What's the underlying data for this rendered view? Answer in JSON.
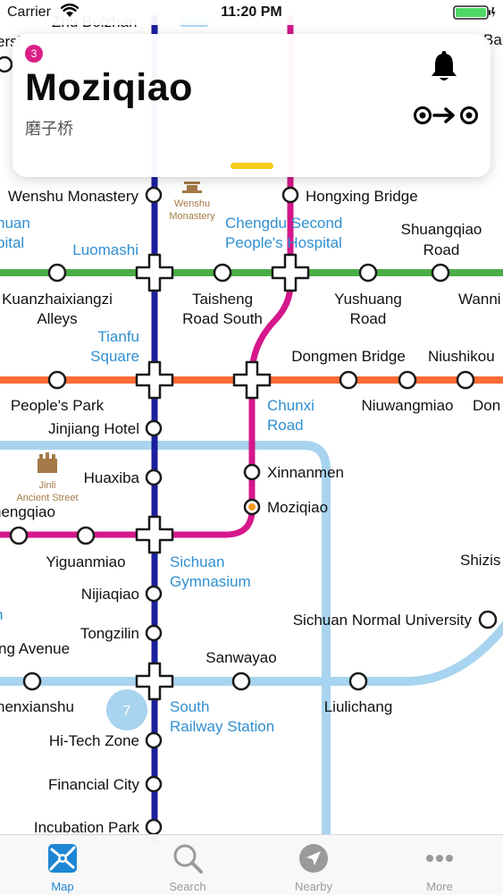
{
  "status_bar": {
    "carrier": "Carrier",
    "time": "11:20 PM"
  },
  "station_card": {
    "badge": "3",
    "title": "Moziqiao",
    "subtitle": "磨子桥",
    "bell_icon": "bell-icon",
    "route_icon": "route-icon"
  },
  "map": {
    "line_colors": {
      "line_1": "#1c1f9e",
      "line_2": "#4aad47",
      "line_3": "#d5178b",
      "line_4": "#ff6a35",
      "line_7": "#a8d4ef"
    },
    "line_badge": "7",
    "edge_labels": [
      "ersi",
      "Zhu Bolzhan",
      "Bal",
      "huan",
      "pital",
      "Wanni",
      "Niushikou",
      "Don",
      "hengqiao",
      "Shizis",
      "n",
      "ng Avenue",
      "henxianshu"
    ],
    "stations": {
      "wenshu_monastery": "Wenshu Monastery",
      "hongxing_bridge": "Hongxing Bridge",
      "chengdu_second_1": "Chengdu Second",
      "chengdu_second_2": "People's Hospital",
      "shuangqiao_1": "Shuangqiao",
      "shuangqiao_2": "Road",
      "luomashi": "Luomashi",
      "kuanzhai_1": "Kuanzhaixiangzi",
      "kuanzhai_2": "Alleys",
      "taisheng_1": "Taisheng",
      "taisheng_2": "Road South",
      "yushuang_1": "Yushuang",
      "yushuang_2": "Road",
      "tianfu_1": "Tianfu",
      "tianfu_2": "Square",
      "dongmen_bridge": "Dongmen Bridge",
      "peoples_park": "People's Park",
      "chunxi_1": "Chunxi",
      "chunxi_2": "Road",
      "niuwangmiao": "Niuwangmiao",
      "jinjiang_hotel": "Jinjiang Hotel",
      "huaxiba": "Huaxiba",
      "xinnanmen": "Xinnanmen",
      "moziqiao": "Moziqiao",
      "yiguanmiao": "Yiguanmiao",
      "sichuan_gym_1": "Sichuan",
      "sichuan_gym_2": "Gymnasium",
      "nijiaqiao": "Nijiaqiao",
      "sichuan_normal": "Sichuan Normal University",
      "tongzilin": "Tongzilin",
      "sanwayao": "Sanwayao",
      "south_rail_1": "South",
      "south_rail_2": "Railway Station",
      "liulichang": "Liulichang",
      "hitech_zone": "Hi-Tech Zone",
      "financial_city": "Financial City",
      "incubation_park": "Incubation Park"
    },
    "landmarks": {
      "wenshu_1": "Wenshu",
      "wenshu_2": "Monastery",
      "jinli_1": "Jinli",
      "jinli_2": "Ancient Street"
    }
  },
  "tab_bar": {
    "active_color": "#1d86d4",
    "tabs": [
      {
        "label": "Map",
        "icon": "map-icon",
        "active": true
      },
      {
        "label": "Search",
        "icon": "search-icon",
        "active": false
      },
      {
        "label": "Nearby",
        "icon": "nearby-icon",
        "active": false
      },
      {
        "label": "More",
        "icon": "more-icon",
        "active": false
      }
    ]
  }
}
